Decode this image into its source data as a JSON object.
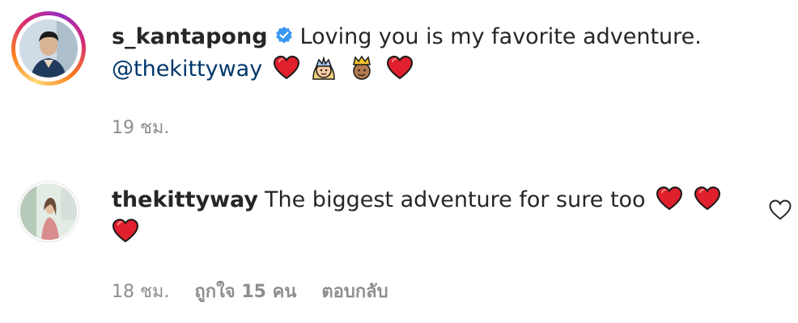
{
  "comment1": {
    "username": "s_kantapong",
    "verified": true,
    "text": "Loving you is my favorite adventure.",
    "mention": "@thekittyway",
    "emojis": [
      "red-heart",
      "princess",
      "prince",
      "red-heart"
    ],
    "time": "19 ชม."
  },
  "comment2": {
    "username": "thekittyway",
    "text": "The biggest adventure for sure too",
    "emojis": [
      "red-heart",
      "red-heart",
      "red-heart"
    ],
    "time": "18 ชม.",
    "likes": "ถูกใจ 15 คน",
    "reply": "ตอบกลับ"
  },
  "colors": {
    "text": "#262626",
    "secondary": "#8e8e8e",
    "mention": "#00376b",
    "verified": "#3897f0",
    "heart": "#e0202d"
  }
}
